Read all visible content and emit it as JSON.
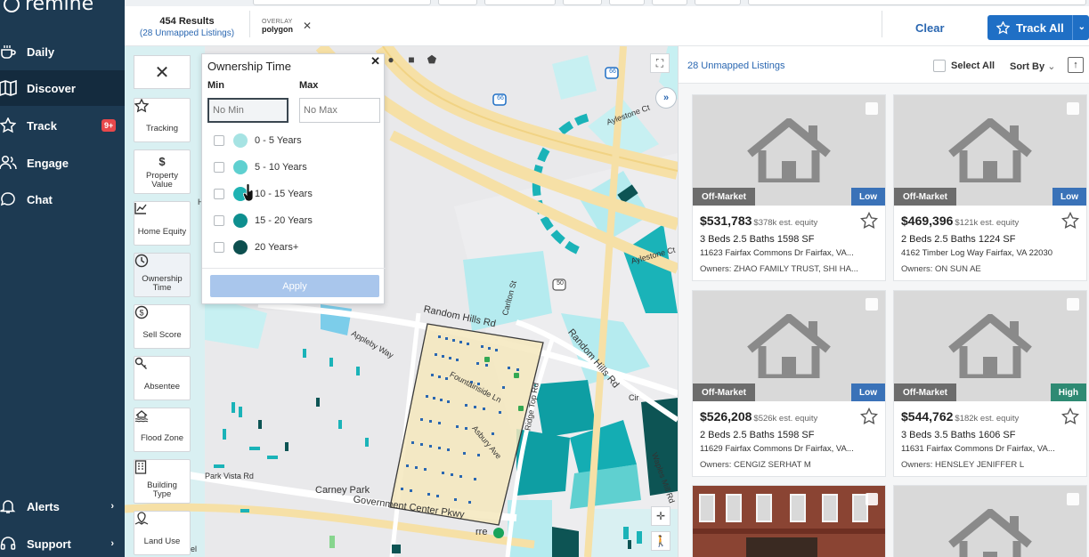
{
  "app": {
    "brand": "remine"
  },
  "sidebar": {
    "items": [
      {
        "label": "Daily",
        "icon": "coffee-icon"
      },
      {
        "label": "Discover",
        "icon": "map-icon",
        "active": true
      },
      {
        "label": "Track",
        "icon": "star-icon",
        "badge": "9+"
      },
      {
        "label": "Engage",
        "icon": "users-icon"
      },
      {
        "label": "Chat",
        "icon": "chat-icon"
      }
    ],
    "bottom": [
      {
        "label": "Alerts",
        "icon": "bell-icon"
      },
      {
        "label": "Support",
        "icon": "headset-icon"
      }
    ]
  },
  "topbar": {
    "results_count": "454 Results",
    "unmapped": "(28 Unmapped Listings)",
    "overlay_label": "OVERLAY",
    "overlay_value": "polygon",
    "clear_label": "Clear",
    "track_all_label": "Track All"
  },
  "map_filters": [
    {
      "label": "Tracking",
      "icon": "star-outline-icon"
    },
    {
      "label": "Property Value",
      "icon": "dollar-icon"
    },
    {
      "label": "Home Equity",
      "icon": "chart-icon"
    },
    {
      "label": "Ownership Time",
      "icon": "clock-icon",
      "active": true
    },
    {
      "label": "Sell Score",
      "icon": "sell-score-icon"
    },
    {
      "label": "Absentee",
      "icon": "key-icon"
    },
    {
      "label": "Flood Zone",
      "icon": "flood-icon"
    },
    {
      "label": "Building Type",
      "icon": "building-icon"
    },
    {
      "label": "Land Use",
      "icon": "land-use-icon"
    }
  ],
  "ownership_popup": {
    "title": "Ownership Time",
    "min_label": "Min",
    "max_label": "Max",
    "min_placeholder": "No Min",
    "max_placeholder": "No Max",
    "options": [
      {
        "label": "0 - 5 Years",
        "color": "#a6e3e3"
      },
      {
        "label": "5 - 10 Years",
        "color": "#5fd0d0"
      },
      {
        "label": "10 - 15 Years",
        "color": "#1fb3b3"
      },
      {
        "label": "15 - 20 Years",
        "color": "#0e8f8f"
      },
      {
        "label": "20 Years+",
        "color": "#0d4f4f"
      }
    ],
    "apply_label": "Apply"
  },
  "map_labels": {
    "road1": "Random Hills Rd",
    "road2": "Random Hills Rd",
    "road3": "Fountainside Ln",
    "road4": "Government Center Pkwy",
    "park": "Carney Park",
    "road5": "Ridge Top Rd",
    "road6": "Appleby Way",
    "road7": "Aylestone Ct",
    "road8": "Aylestone Ct",
    "road9": "Park Vista Rd",
    "road10": "Carlton St",
    "road11": "Asbury Ave",
    "shield1": "66",
    "shield2": "66",
    "shield3": "50",
    "partial1": "Hills",
    "partial2": "Cir",
    "partial3": "Waples Mill Rd",
    "partial4": "Sel",
    "partial5": "rre"
  },
  "listings": {
    "unmapped_label": "28 Unmapped Listings",
    "select_all_label": "Select All",
    "sort_label": "Sort By",
    "cards": [
      {
        "status": "Off-Market",
        "level": "Low",
        "level_color": "#3a72b8",
        "price": "$531,783",
        "equity": "$378k est. equity",
        "specs": "3 Beds  2.5 Baths  1598 SF",
        "address": "11623 Fairfax Commons Dr Fairfax, VA...",
        "owners": "Owners: ZHAO FAMILY TRUST, SHI HA..."
      },
      {
        "status": "Off-Market",
        "level": "Low",
        "level_color": "#3a72b8",
        "price": "$469,396",
        "equity": "$121k est. equity",
        "specs": "2 Beds  2.5 Baths  1224 SF",
        "address": "4162 Timber Log Way Fairfax, VA 22030",
        "owners": "Owners: ON SUN AE"
      },
      {
        "status": "Off-Market",
        "level": "Low",
        "level_color": "#3a72b8",
        "price": "$526,208",
        "equity": "$526k est. equity",
        "specs": "2 Beds  2.5 Baths  1598 SF",
        "address": "11629 Fairfax Commons Dr Fairfax, VA...",
        "owners": "Owners: CENGIZ SERHAT M"
      },
      {
        "status": "Off-Market",
        "level": "High",
        "level_color": "#2e8a73",
        "price": "$544,762",
        "equity": "$182k est. equity",
        "specs": "3 Beds  3.5 Baths  1606 SF",
        "address": "11631 Fairfax Commons Dr Fairfax, VA...",
        "owners": "Owners: HENSLEY JENIFFER L"
      }
    ]
  }
}
